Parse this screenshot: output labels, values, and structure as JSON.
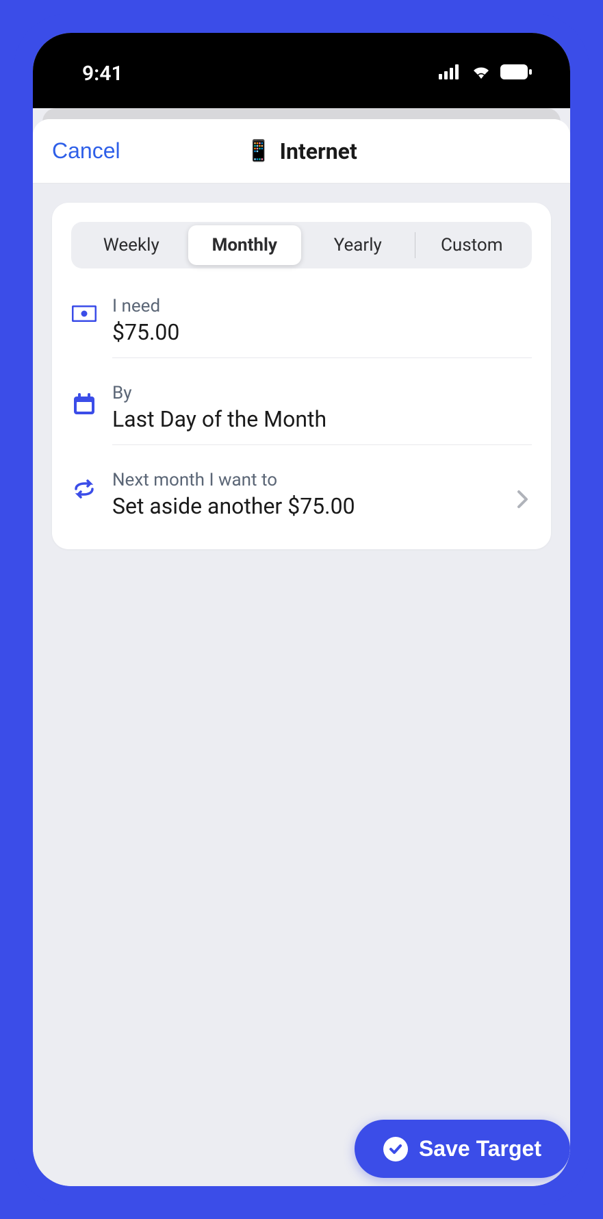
{
  "status": {
    "time": "9:41"
  },
  "header": {
    "cancel": "Cancel",
    "emoji": "📱",
    "title": "Internet"
  },
  "segments": {
    "weekly": "Weekly",
    "monthly": "Monthly",
    "yearly": "Yearly",
    "custom": "Custom",
    "active": "monthly"
  },
  "rows": {
    "need": {
      "label": "I need",
      "value": "$75.00"
    },
    "by": {
      "label": "By",
      "value": "Last Day of the Month"
    },
    "next": {
      "label": "Next month I want to",
      "value": "Set aside another $75.00"
    }
  },
  "footer": {
    "save": "Save Target"
  }
}
